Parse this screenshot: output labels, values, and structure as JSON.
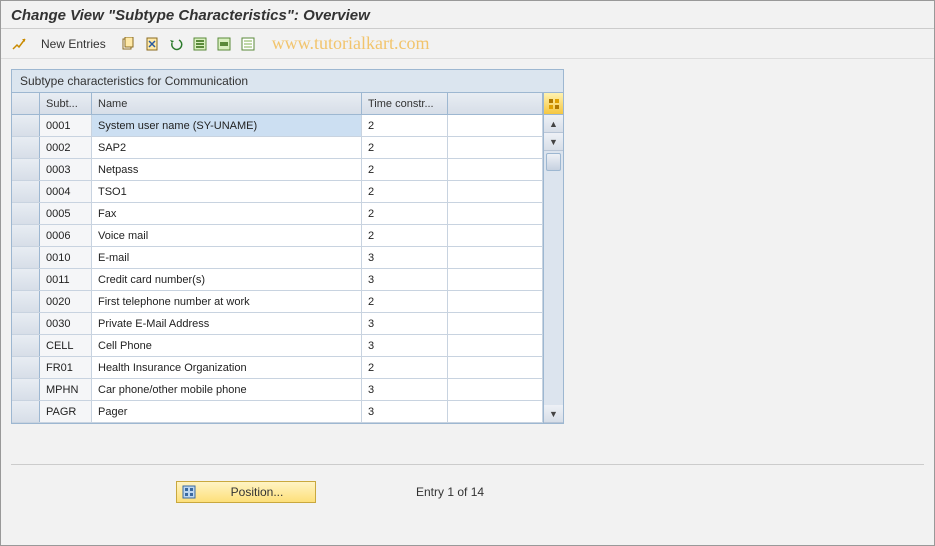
{
  "title": "Change View \"Subtype Characteristics\": Overview",
  "toolbar": {
    "new_entries_label": "New Entries"
  },
  "watermark": "www.tutorialkart.com",
  "panel": {
    "header": "Subtype characteristics for Communication",
    "columns": {
      "subt": "Subt...",
      "name": "Name",
      "time": "Time constr..."
    },
    "rows": [
      {
        "subt": "0001",
        "name": "System user name (SY-UNAME)",
        "time": "2",
        "selected": true
      },
      {
        "subt": "0002",
        "name": "SAP2",
        "time": "2",
        "selected": false
      },
      {
        "subt": "0003",
        "name": "Netpass",
        "time": "2",
        "selected": false
      },
      {
        "subt": "0004",
        "name": "TSO1",
        "time": "2",
        "selected": false
      },
      {
        "subt": "0005",
        "name": "Fax",
        "time": "2",
        "selected": false
      },
      {
        "subt": "0006",
        "name": "Voice mail",
        "time": "2",
        "selected": false
      },
      {
        "subt": "0010",
        "name": "E-mail",
        "time": "3",
        "selected": false
      },
      {
        "subt": "0011",
        "name": "Credit card number(s)",
        "time": "3",
        "selected": false
      },
      {
        "subt": "0020",
        "name": "First telephone number at work",
        "time": "2",
        "selected": false
      },
      {
        "subt": "0030",
        "name": "Private E-Mail Address",
        "time": "3",
        "selected": false
      },
      {
        "subt": "CELL",
        "name": "Cell Phone",
        "time": "3",
        "selected": false
      },
      {
        "subt": "FR01",
        "name": "Health Insurance Organization",
        "time": "2",
        "selected": false
      },
      {
        "subt": "MPHN",
        "name": "Car phone/other mobile phone",
        "time": "3",
        "selected": false
      },
      {
        "subt": "PAGR",
        "name": "Pager",
        "time": "3",
        "selected": false
      }
    ]
  },
  "footer": {
    "position_label": "Position...",
    "entry_status": "Entry 1 of 14"
  }
}
